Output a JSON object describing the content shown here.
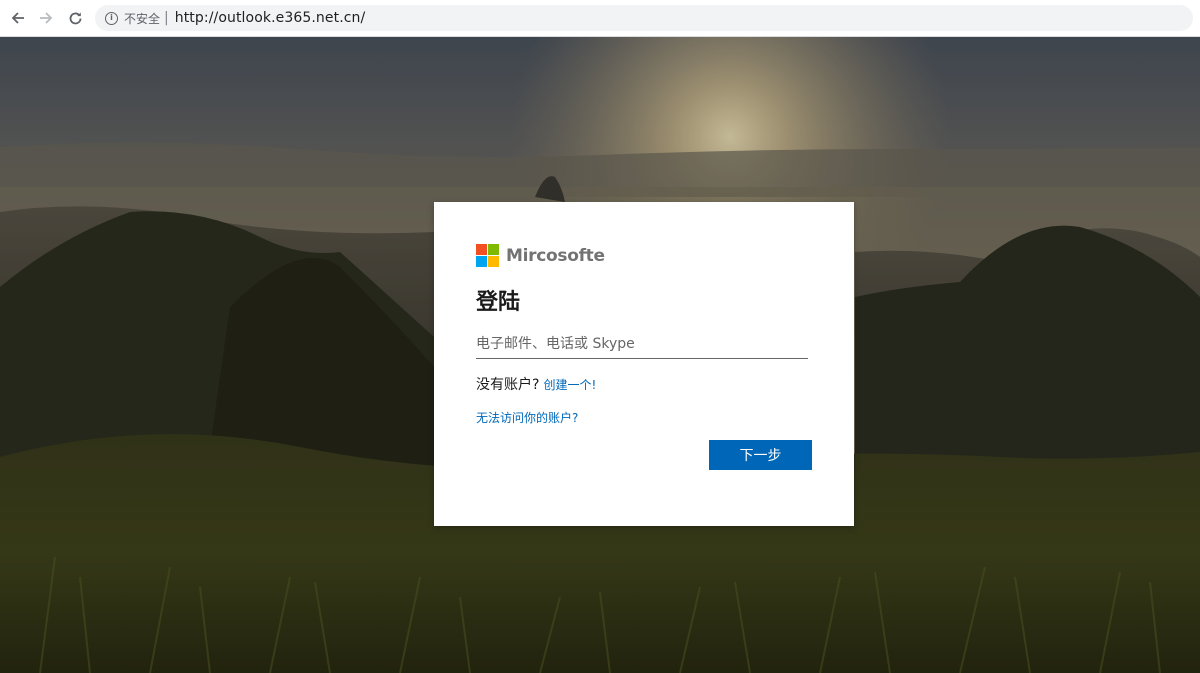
{
  "browser": {
    "security_label": "不安全",
    "separator": "|",
    "url": "http://outlook.e365.net.cn/"
  },
  "brand": {
    "name": "Mircosofte",
    "logo_colors": [
      "#f25022",
      "#7fba00",
      "#00a4ef",
      "#ffb900"
    ]
  },
  "login": {
    "title": "登陆",
    "email_placeholder": "电子邮件、电话或 Skype",
    "email_value": "",
    "no_account_text": "没有账户?",
    "create_link": "创建一个!",
    "cant_access_link": "无法访问你的账户?",
    "next_button": "下一步"
  },
  "colors": {
    "accent": "#0067b8",
    "link": "#0067b8",
    "card_bg": "#ffffff"
  },
  "icons": {
    "back": "arrow-left-icon",
    "forward": "arrow-right-icon",
    "reload": "reload-icon",
    "security": "info-icon"
  }
}
